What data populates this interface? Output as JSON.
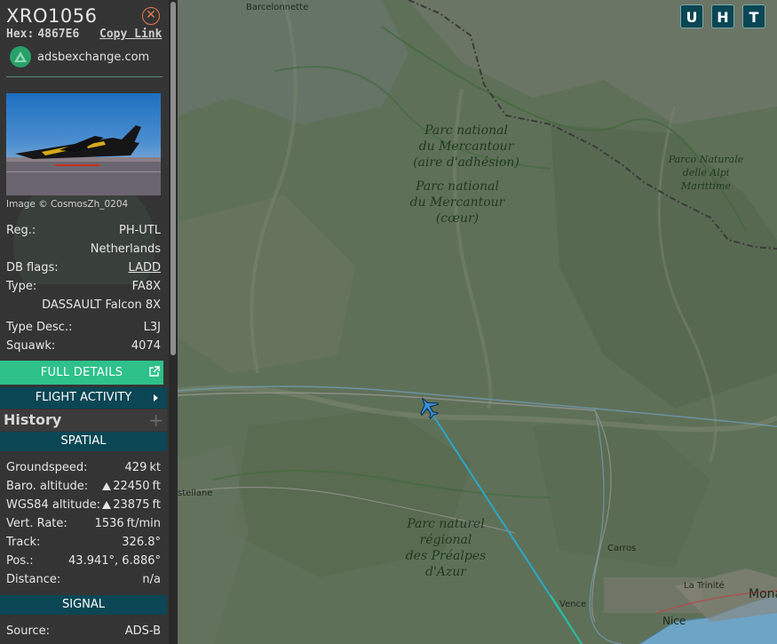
{
  "aircraft": {
    "callsign": "XRO1056",
    "hex_label": "Hex:",
    "hex": "4867E6",
    "copy_link": "Copy Link",
    "source_site": "adsbexchange.com",
    "photo_credit": "Image © CosmosZh_0204"
  },
  "details": {
    "reg_label": "Reg.:",
    "reg": "PH-UTL",
    "country": "Netherlands",
    "dbflags_label": "DB flags:",
    "dbflags": "LADD",
    "type_label": "Type:",
    "type": "FA8X",
    "type_name": "DASSAULT Falcon 8X",
    "typedesc_label": "Type Desc.:",
    "typedesc": "L3J",
    "squawk_label": "Squawk:",
    "squawk": "4074"
  },
  "buttons": {
    "full_details": "FULL DETAILS",
    "flight_activity": "FLIGHT ACTIVITY"
  },
  "history": {
    "title": "History",
    "plus": "+"
  },
  "spatial": {
    "title": "SPATIAL",
    "groundspeed_label": "Groundspeed:",
    "groundspeed": "429",
    "groundspeed_unit": "kt",
    "baro_label": "Baro. altitude:",
    "baro": "22450",
    "baro_unit": "ft",
    "wgs_label": "WGS84 altitude:",
    "wgs": "23875",
    "wgs_unit": "ft",
    "vrate_label": "Vert. Rate:",
    "vrate": "1536",
    "vrate_unit": "ft/min",
    "track_label": "Track:",
    "track": "326.8°",
    "pos_label": "Pos.:",
    "pos": "43.941°, 6.886°",
    "distance_label": "Distance:",
    "distance": "n/a"
  },
  "signal": {
    "title": "SIGNAL",
    "source_label": "Source:",
    "source": "ADS-B"
  },
  "map": {
    "layer_buttons": [
      "U",
      "H",
      "T"
    ],
    "labels": {
      "barcelonnette": "Barcelonnette",
      "mercantour_adhesion": [
        "Parc national",
        "du Mercantour",
        "(aire d'adhésion)"
      ],
      "mercantour_coeur": [
        "Parc national",
        "du Mercantour",
        "(cœur)"
      ],
      "alpi_marittime": [
        "Parco Naturale",
        "delle Alpi",
        "Marittime"
      ],
      "prealpes": [
        "Parc naturel",
        "régional",
        "des Préalpes",
        "d'Azur"
      ],
      "castellane": "stellane",
      "carros": "Carros",
      "vence": "Vence",
      "trinite": "La Trinité",
      "nice": "Nice",
      "monaco": "Mona"
    },
    "track_color": "#2aa8c8",
    "aircraft_color": "#3a8fd8"
  },
  "colors": {
    "sidebar_bg": "#343434",
    "accent_green": "#2ec18a",
    "section_teal": "#0b4654",
    "close_orange": "#e27c4e"
  }
}
